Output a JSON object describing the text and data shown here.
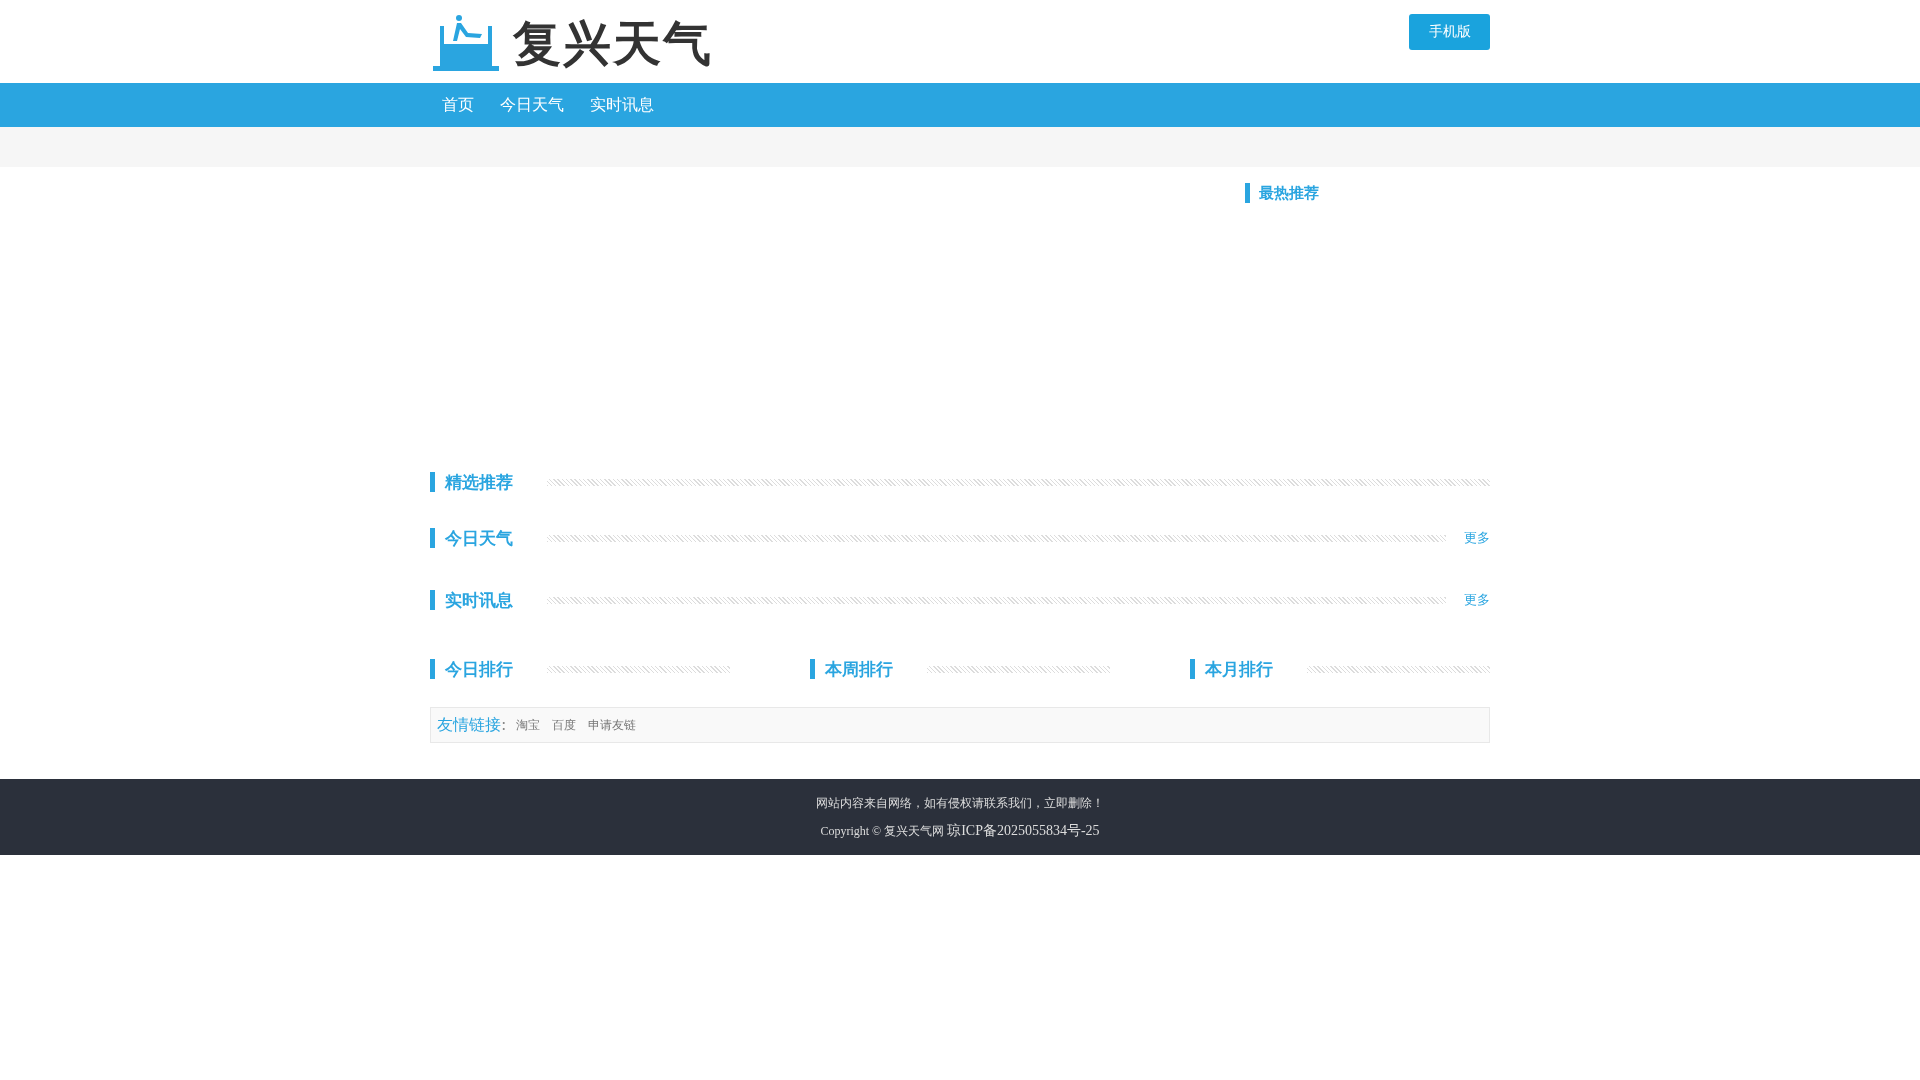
{
  "header": {
    "logo_text": "复兴天气",
    "mobile_button": "手机版"
  },
  "nav": [
    {
      "label": "首页"
    },
    {
      "label": "今日天气"
    },
    {
      "label": "实时讯息"
    }
  ],
  "sidebar": {
    "title": "最热推荐"
  },
  "sections": [
    {
      "title": "精选推荐"
    },
    {
      "title": "今日天气",
      "more": "更多"
    },
    {
      "title": "实时讯息",
      "more": "更多"
    }
  ],
  "rankings": [
    {
      "title": "今日排行"
    },
    {
      "title": "本周排行"
    },
    {
      "title": "本月排行"
    }
  ],
  "friend_links": {
    "label": "友情链接",
    "separator": ":",
    "links": [
      "淘宝",
      "百度",
      "申请友链"
    ]
  },
  "footer": {
    "notice": "网站内容来自网络，如有侵权请联系我们，立即删除！",
    "copyright": "Copyright © 复兴天气网",
    "icp": "琼ICP备2025055834号-25"
  }
}
